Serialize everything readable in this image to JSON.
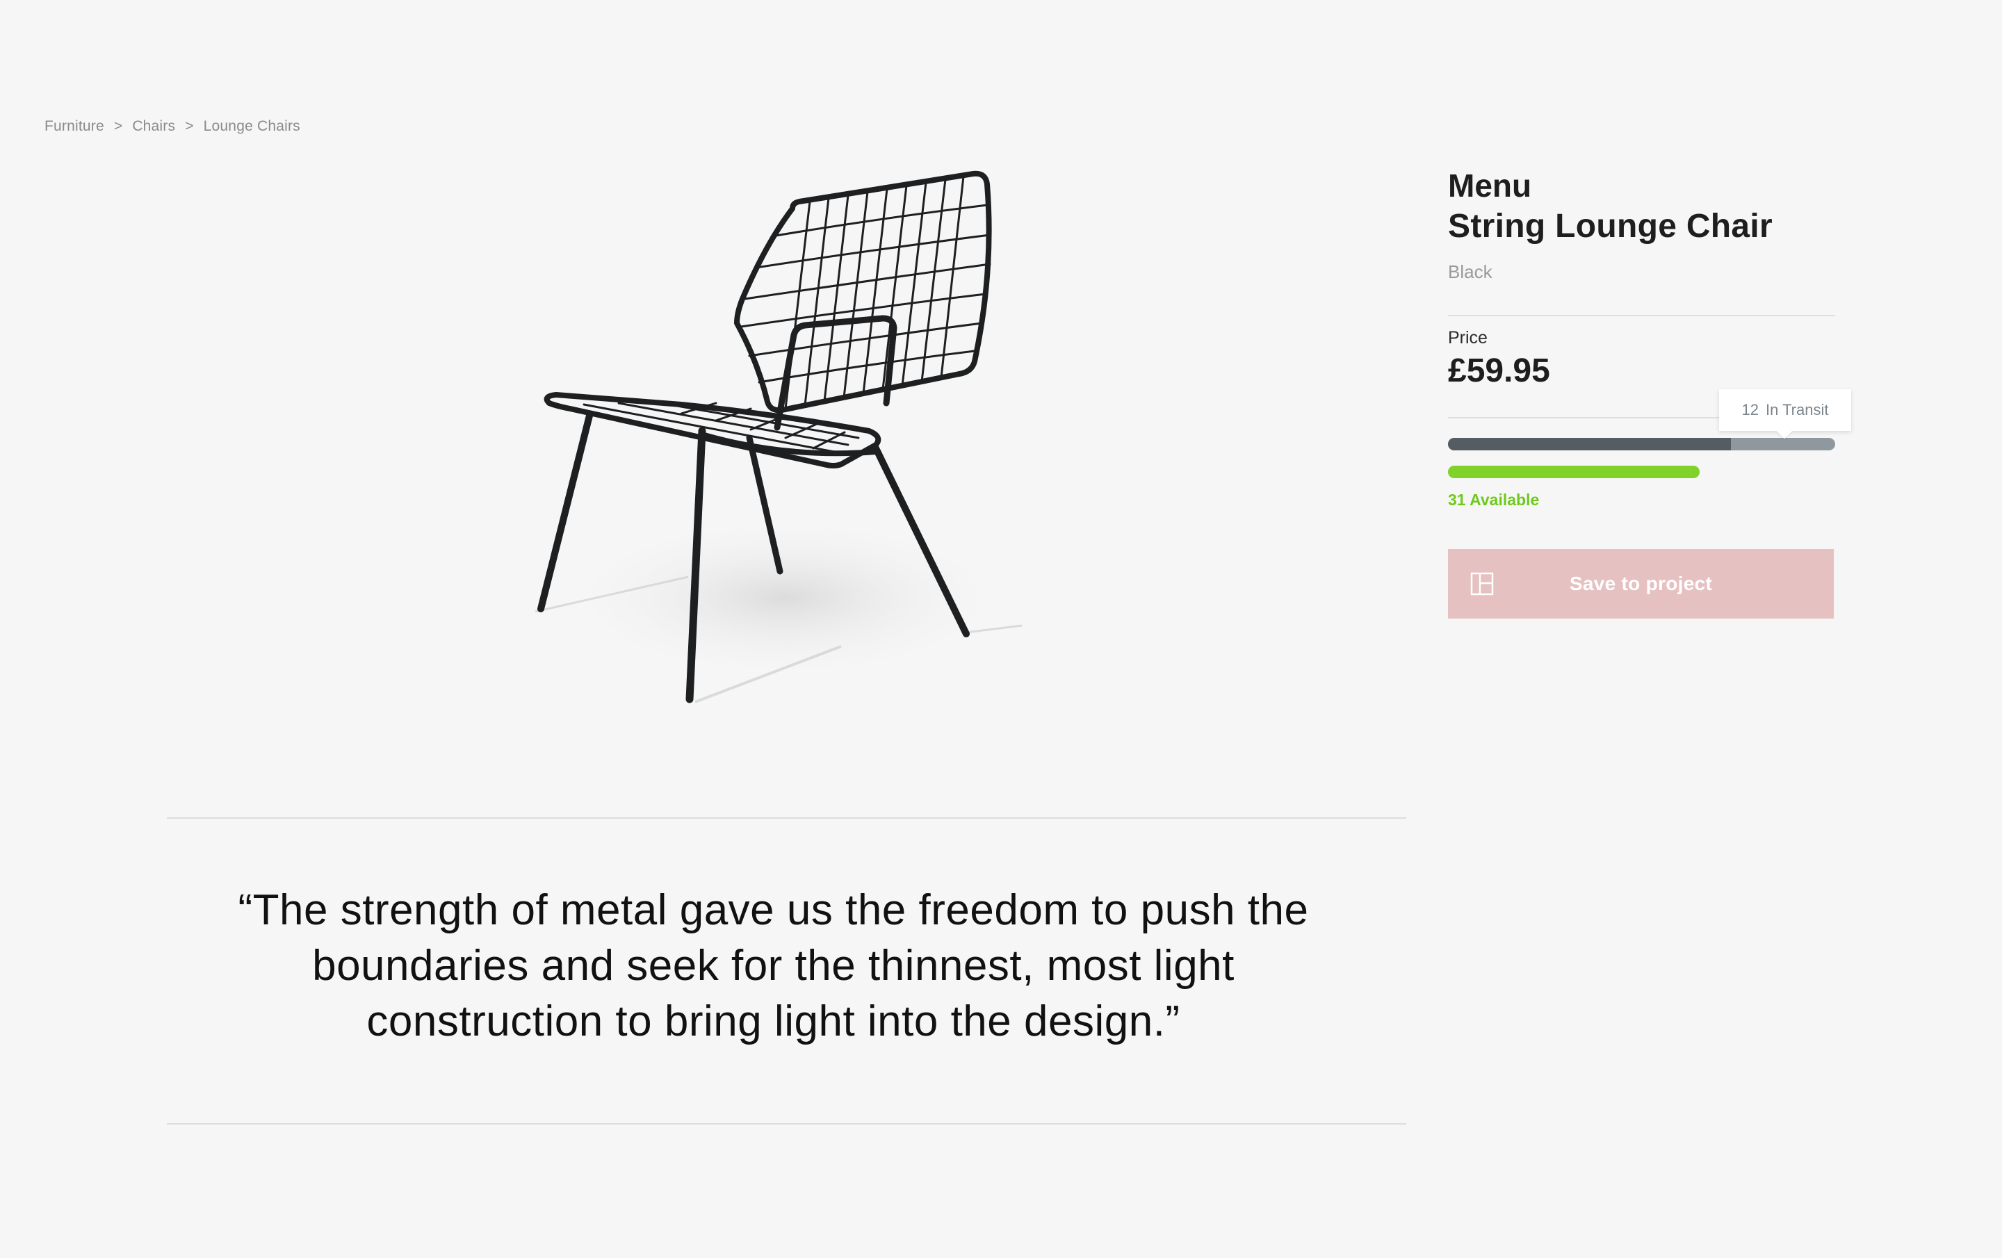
{
  "breadcrumb": {
    "items": [
      "Furniture",
      "Chairs",
      "Lounge Chairs"
    ],
    "separator": ">"
  },
  "product": {
    "brand": "Menu",
    "name": "String Lounge Chair",
    "variant": "Black",
    "image_alt": "black wire lounge chair"
  },
  "price": {
    "label": "Price",
    "value": "£59.95"
  },
  "stock": {
    "in_transit_count": "12",
    "in_transit_label": "In Transit",
    "available_text": "31 Available",
    "in_stock_share": 0.73,
    "available_share": 0.65,
    "colors": {
      "in_stock": "#545d63",
      "in_transit": "#8e989e",
      "available": "#80d12a"
    }
  },
  "actions": {
    "save_label": "Save to project",
    "save_icon": "layout-grid-icon",
    "save_color": "#e6c1c1"
  },
  "quote": {
    "text": "“The strength of metal gave us the freedom to push the boundaries and seek for the thinnest, most light construction to bring light into the design.”"
  }
}
